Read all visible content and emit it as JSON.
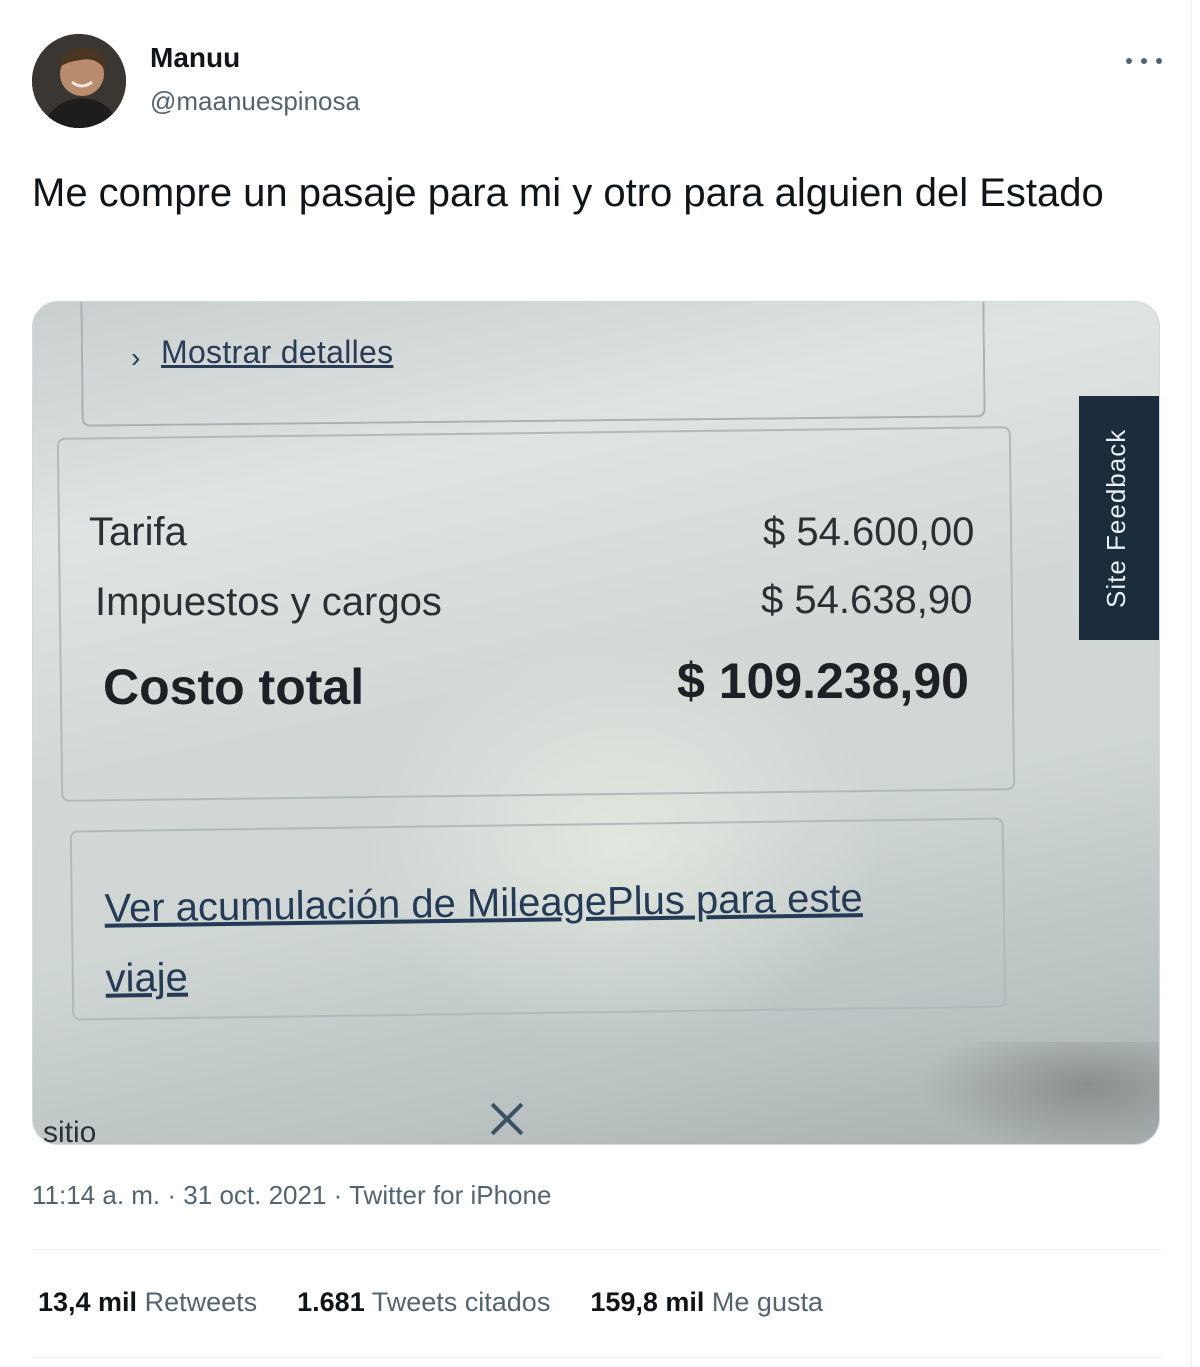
{
  "author": {
    "name": "Manuu",
    "handle": "@maanuespinosa"
  },
  "tweet": {
    "text": "Me compre un pasaje para mi y otro para alguien del Estado"
  },
  "photo": {
    "link_details": "Mostrar detalles",
    "rows": [
      {
        "label": "Tarifa",
        "value": "$ 54.600,00"
      },
      {
        "label": "Impuestos y cargos",
        "value": "$ 54.638,90"
      },
      {
        "label": "Costo total",
        "value": "$ 109.238,90"
      }
    ],
    "link_miles": "Ver acumulación de MileagePlus para este viaje",
    "feedback_tab": "Site Feedback",
    "bottom_fragment": "sitio"
  },
  "meta": {
    "time": "11:14 a. m.",
    "date": "31 oct. 2021",
    "source": "Twitter for iPhone",
    "separator": "·"
  },
  "stats": [
    {
      "count": "13,4 mil",
      "label": "Retweets"
    },
    {
      "count": "1.681",
      "label": "Tweets citados"
    },
    {
      "count": "159,8 mil",
      "label": "Me gusta"
    }
  ],
  "icons": {
    "more": "more-horizontal-icon",
    "chevron": "chevron-right-icon",
    "close": "close-icon"
  },
  "colors": {
    "text_primary": "#0f1419",
    "text_secondary": "#536471",
    "feedback_tab": "#1b2d3c"
  }
}
